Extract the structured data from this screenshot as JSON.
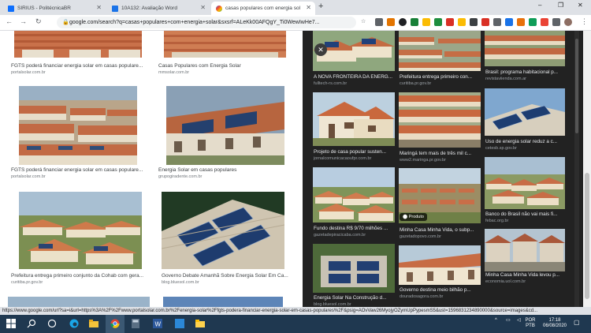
{
  "tabs": [
    {
      "title": "SIRIUS - PolitécnicaBR",
      "color": "#0d6efd"
    },
    {
      "title": "10A132: Avaliação Word",
      "color": "#1a73e8"
    },
    {
      "title": "casas populares com energia sola",
      "color": "#4285f4"
    }
  ],
  "window_controls": {
    "minimize": "–",
    "restore": "❐",
    "close": "✕"
  },
  "address_bar": {
    "url": "google.com/search?q=casas+populares+com+energia+solar&sxsrf=ALeKk00AFQgY_Ti0WewIwHe7..."
  },
  "results": [
    {
      "caption": "FGTS poderá financiar energia solar em casas populare...",
      "source": "portalsolar.com.br"
    },
    {
      "caption": "Casas Populares com Energia Solar",
      "source": "mmsolar.com.br"
    },
    {
      "caption": "FGTS poderá financiar energia solar em casas populare...",
      "source": "portalsolar.com.br"
    },
    {
      "caption": "Energia Solar em casas populares",
      "source": "grupogiradente.com.br"
    },
    {
      "caption": "Prefeitura entrega primeiro conjunto da Cohab com gera...",
      "source": "curitiba.pr.gov.br"
    },
    {
      "caption": "Governo Debate Amanhã Sobre Energia Solar Em Ca...",
      "source": "blog.bluesol.com.br"
    }
  ],
  "panel": [
    {
      "caption": "A NOVA FRONTEIRA DA ENERG...",
      "source": "fulltech-rs.com.br"
    },
    {
      "caption": "Prefeitura entrega primeiro con...",
      "source": "curitiba.pr.gov.br"
    },
    {
      "caption": "Brasil: programa habitacional p...",
      "source": "revistaviienda.com.ar"
    },
    {
      "caption": "Projeto de casa popular susten...",
      "source": "jornalcomunicacaoufpr.com.br"
    },
    {
      "caption": "Maringá tem mais de três mil c...",
      "source": "www2.maringa.pr.gov.br"
    },
    {
      "caption": "Uso de energia solar reduz a c...",
      "source": "cetesb.sp.gov.br"
    },
    {
      "caption": "Fundo destina R$ 9/70 milhões ...",
      "source": "gazetadepiracicaba.com.br"
    },
    {
      "caption": "Minha Casa Minha Vida, o subp...",
      "source": "gazetadopovo.com.br"
    },
    {
      "caption": "Banco do Brasil não vai mais fi...",
      "source": "febac.org.br"
    },
    {
      "caption": "Energia Solar Na Construção d...",
      "source": "blog.bluesol.com.br"
    },
    {
      "caption": "Governo destina meio bilhão p...",
      "source": "douradosagora.com.br"
    },
    {
      "caption": "Minha Casa Minha Vida levou p...",
      "source": "economia.uol.com.br"
    }
  ],
  "product_badge": "Produto",
  "status_bar": {
    "text": "https://www.google.com/url?sa=i&url=https%3A%2F%2Fwww.portalsolar.com.br%2Fenergia-solar%2Ffgts-podera-financiar-energia-solar-em-casas-populares%2F&psig=AOvVaw26MyojyOZymUpPypesmS5&ust=1596831234890000&source=images&cd..."
  },
  "taskbar": {
    "lang": "POR",
    "layout": "PTB",
    "time": "17:18",
    "date": "06/08/2020"
  }
}
